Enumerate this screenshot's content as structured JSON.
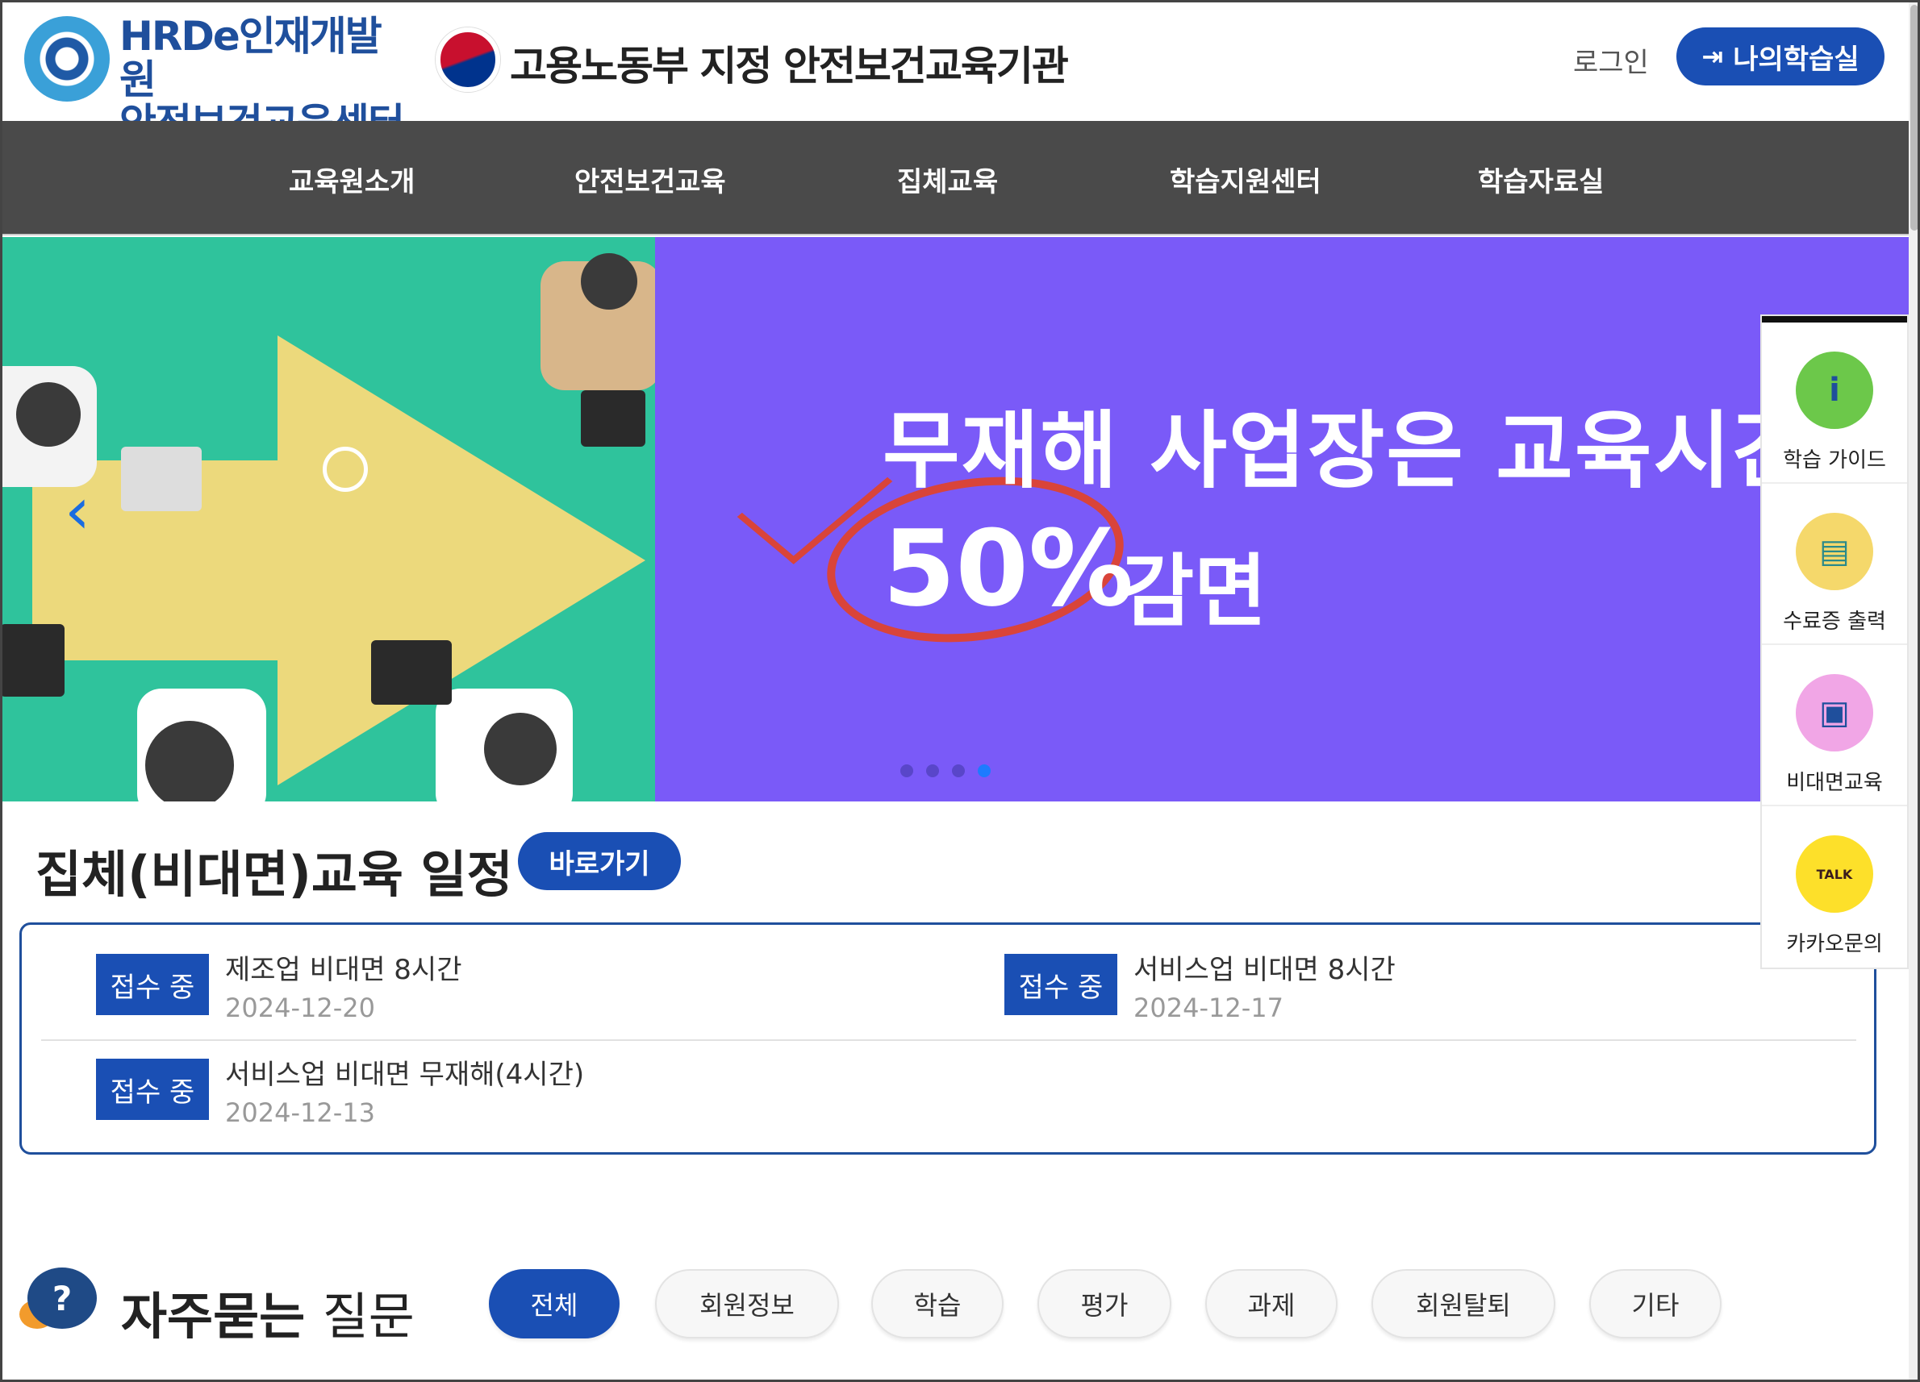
{
  "header": {
    "logo_line1": "HRDe인재개발원",
    "logo_line2": "안전보건교육센터",
    "gov_label": "고용노동부 지정 안전보건교육기관",
    "login_label": "로그인",
    "my_classroom_label": "나의학습실"
  },
  "nav": {
    "items": [
      {
        "label": "교육원소개"
      },
      {
        "label": "안전보건교육"
      },
      {
        "label": "집체교육"
      },
      {
        "label": "학습지원센터"
      },
      {
        "label": "학습자료실"
      }
    ]
  },
  "banner": {
    "line1": "무재해 사업장은 교육시간",
    "percent": "50%",
    "line2_suffix": "감면",
    "slide_count": 4,
    "active_slide": 4,
    "colors": {
      "background": "#7a5af8",
      "photo_bg": "#2fc39c",
      "accent_red": "#d9443a"
    }
  },
  "quick_menu": {
    "items": [
      {
        "label": "학습 가이드",
        "icon": "info-book-icon"
      },
      {
        "label": "수료증 출력",
        "icon": "certificate-icon"
      },
      {
        "label": "비대면교육",
        "icon": "video-lecture-icon"
      },
      {
        "label": "카카오문의",
        "icon": "kakao-talk-icon",
        "icon_text": "TALK"
      }
    ]
  },
  "schedule": {
    "title": "집체(비대면)교육 일정",
    "go_label": "바로가기",
    "entries": [
      {
        "status": "접수 중",
        "title": "제조업 비대면 8시간",
        "date": "2024-12-20"
      },
      {
        "status": "접수 중",
        "title": "서비스업 비대면 8시간",
        "date": "2024-12-17"
      },
      {
        "status": "접수 중",
        "title": "서비스업 비대면 무재해(4시간)",
        "date": "2024-12-13"
      }
    ]
  },
  "faq": {
    "title_bold": "자주묻는",
    "title_light": "질문",
    "icon_glyph": "?",
    "tabs": [
      {
        "label": "전체",
        "active": true
      },
      {
        "label": "회원정보",
        "active": false
      },
      {
        "label": "학습",
        "active": false
      },
      {
        "label": "평가",
        "active": false
      },
      {
        "label": "과제",
        "active": false
      },
      {
        "label": "회원탈퇴",
        "active": false
      },
      {
        "label": "기타",
        "active": false
      }
    ]
  },
  "colors": {
    "brand_blue": "#1a4fb4",
    "nav_bg": "#4a4a4a"
  }
}
